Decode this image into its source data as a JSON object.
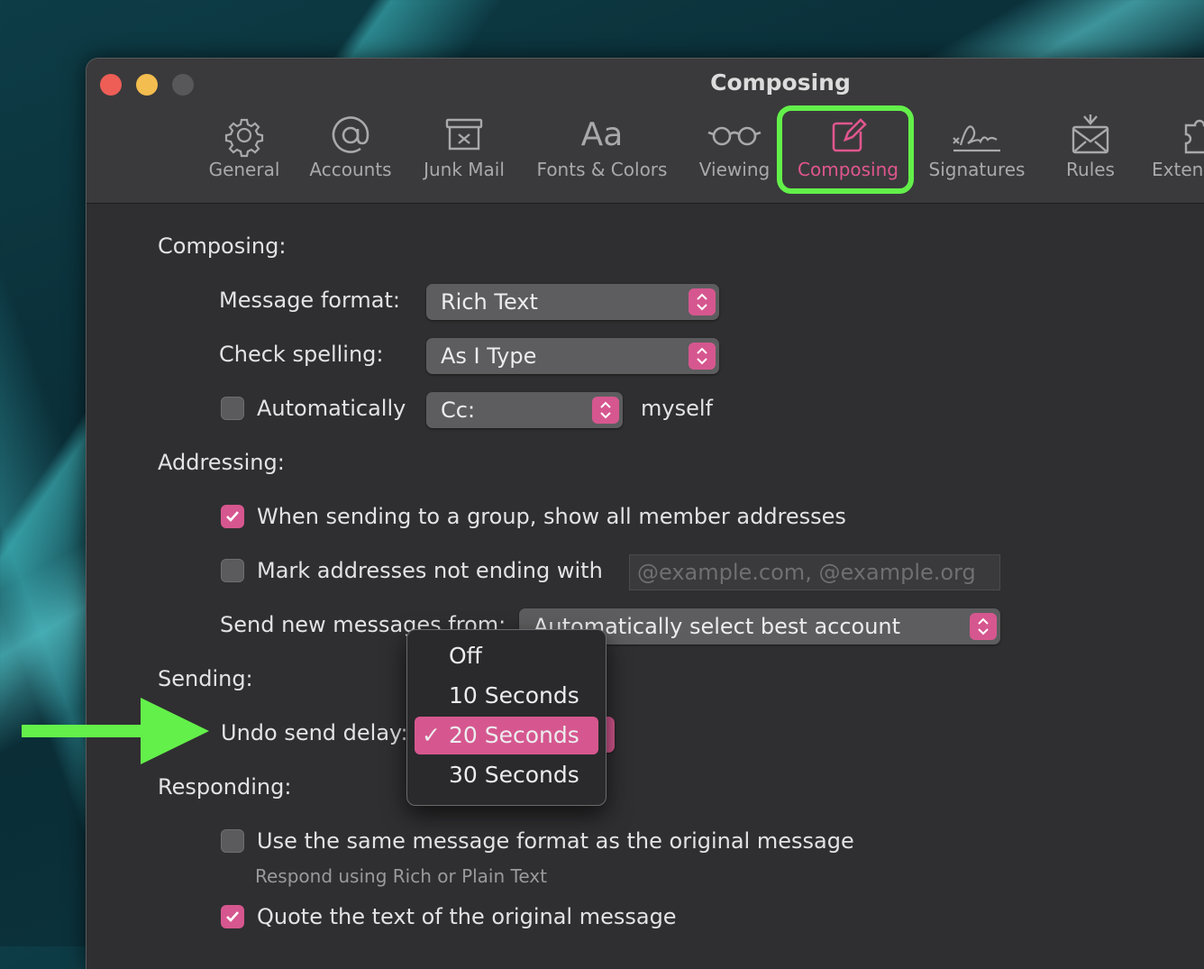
{
  "window": {
    "title": "Composing"
  },
  "toolbar": {
    "items": [
      {
        "label": "General",
        "icon": "gear-icon"
      },
      {
        "label": "Accounts",
        "icon": "at-sign-icon"
      },
      {
        "label": "Junk Mail",
        "icon": "junk-mail-icon"
      },
      {
        "label": "Fonts & Colors",
        "icon": "fonts-icon"
      },
      {
        "label": "Viewing",
        "icon": "glasses-icon"
      },
      {
        "label": "Composing",
        "icon": "compose-icon"
      },
      {
        "label": "Signatures",
        "icon": "signature-icon"
      },
      {
        "label": "Rules",
        "icon": "rules-envelope-icon"
      },
      {
        "label": "Exten",
        "icon": "puzzle-piece-icon"
      }
    ],
    "selected": "Composing",
    "fonts_icon_glyph": "Aa"
  },
  "composing": {
    "heading": "Composing:",
    "message_format_label": "Message format:",
    "message_format_value": "Rich Text",
    "check_spelling_label": "Check spelling:",
    "check_spelling_value": "As I Type",
    "auto_label": "Automatically",
    "auto_value": "Cc:",
    "auto_suffix": "myself",
    "auto_checked": false
  },
  "addressing": {
    "heading": "Addressing:",
    "show_members_label": "When sending to a group, show all member addresses",
    "show_members_checked": true,
    "mark_addresses_label": "Mark addresses not ending with",
    "mark_addresses_checked": false,
    "mark_addresses_placeholder": "@example.com, @example.org",
    "send_from_label": "Send new messages from:",
    "send_from_value": "Automatically select best account"
  },
  "sending": {
    "heading": "Sending:",
    "undo_label": "Undo send delay:",
    "menu_options": [
      "Off",
      "10 Seconds",
      "20 Seconds",
      "30 Seconds"
    ],
    "selected_option": "20 Seconds",
    "check_glyph": "✓"
  },
  "responding": {
    "heading": "Responding:",
    "same_format_label": "Use the same message format as the original message",
    "same_format_checked": false,
    "same_format_sub": "Respond using Rich or Plain Text",
    "quote_label": "Quote the text of the original message",
    "quote_checked": true
  },
  "colors": {
    "accent": "#d6578f",
    "highlight_box": "#63f04a",
    "arrow": "#63f04a"
  }
}
